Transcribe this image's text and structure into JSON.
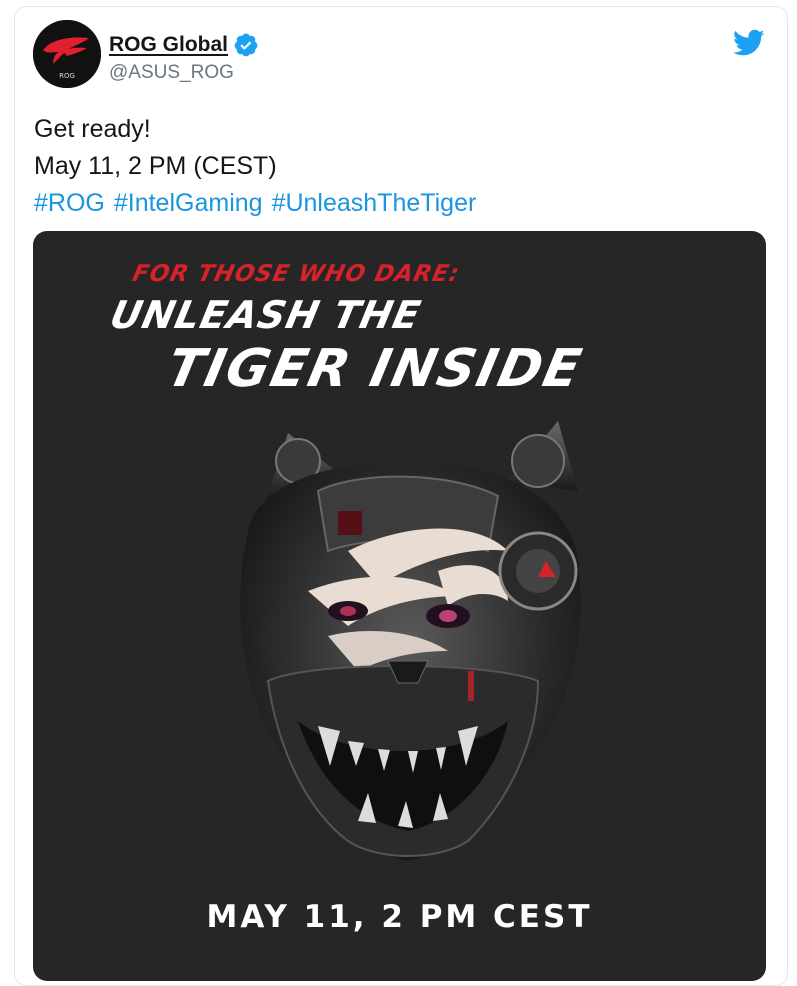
{
  "tweet": {
    "display_name": "ROG Global",
    "handle": "@ASUS_ROG",
    "verified_icon": "verified-badge-icon",
    "platform_icon": "twitter-bird-icon",
    "avatar": {
      "label": "ROG"
    },
    "text_lines": [
      "Get ready!",
      "May 11, 2 PM (CEST)"
    ],
    "hashtags": [
      "#ROG",
      "#IntelGaming",
      "#UnleashTheTiger"
    ]
  },
  "media": {
    "tagline": "FOR THOSE WHO DARE:",
    "headline_1": "UNLEASH THE",
    "headline_2": "TIGER INSIDE",
    "date": "MAY 11, 2 PM CEST",
    "image_subject": "mechanical-tiger-head"
  },
  "colors": {
    "link": "#1b95e0",
    "verified": "#1da1f2",
    "twitter": "#1da1f2",
    "media_bg": "#262626",
    "accent_red": "#d8222a"
  }
}
